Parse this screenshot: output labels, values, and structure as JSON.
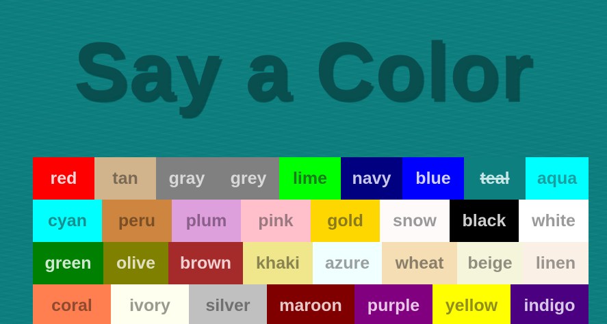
{
  "title": "Say a Color",
  "rows": [
    [
      {
        "label": "red",
        "bg": "#ff0000",
        "fg": "#f5d7d7",
        "w": 90
      },
      {
        "label": "tan",
        "bg": "#d2b48c",
        "fg": "#7a6a55",
        "w": 90
      },
      {
        "label": "gray",
        "bg": "#808080",
        "fg": "#d8d8d8",
        "w": 90
      },
      {
        "label": "grey",
        "bg": "#808080",
        "fg": "#d8d8d8",
        "w": 90
      },
      {
        "label": "lime",
        "bg": "#00ff00",
        "fg": "#1b7a1b",
        "w": 90
      },
      {
        "label": "navy",
        "bg": "#000080",
        "fg": "#c8c8e6",
        "w": 90
      },
      {
        "label": "blue",
        "bg": "#0000ff",
        "fg": "#d0d0f8",
        "w": 90
      },
      {
        "label": "teal",
        "bg": "#0d7f7f",
        "fg": "#c8e6e6",
        "w": 90,
        "crossed": true
      },
      {
        "label": "aqua",
        "bg": "#00ffff",
        "fg": "#1aa0a0",
        "w": 92
      }
    ],
    [
      {
        "label": "cyan",
        "bg": "#00ffff",
        "fg": "#1a8f8f",
        "w": 101
      },
      {
        "label": "peru",
        "bg": "#cd853f",
        "fg": "#7a4f25",
        "w": 102
      },
      {
        "label": "plum",
        "bg": "#dda0dd",
        "fg": "#8a5f8a",
        "w": 101
      },
      {
        "label": "pink",
        "bg": "#ffc0cb",
        "fg": "#9a7a80",
        "w": 102
      },
      {
        "label": "gold",
        "bg": "#ffd700",
        "fg": "#8a7a20",
        "w": 101
      },
      {
        "label": "snow",
        "bg": "#fffafa",
        "fg": "#9a9a9a",
        "w": 102
      },
      {
        "label": "black",
        "bg": "#000000",
        "fg": "#cfcfcf",
        "w": 101
      },
      {
        "label": "white",
        "bg": "#ffffff",
        "fg": "#9a9a9a",
        "w": 102
      }
    ],
    [
      {
        "label": "green",
        "bg": "#008000",
        "fg": "#cfe8cf",
        "w": 103
      },
      {
        "label": "olive",
        "bg": "#808000",
        "fg": "#e0e0c0",
        "w": 95
      },
      {
        "label": "brown",
        "bg": "#a52a2a",
        "fg": "#f0d0d0",
        "w": 109
      },
      {
        "label": "khaki",
        "bg": "#f0e68c",
        "fg": "#8a8450",
        "w": 102
      },
      {
        "label": "azure",
        "bg": "#f0ffff",
        "fg": "#9aa0a0",
        "w": 101
      },
      {
        "label": "wheat",
        "bg": "#f5deb3",
        "fg": "#8a7f6a",
        "w": 110
      },
      {
        "label": "beige",
        "bg": "#f5f5dc",
        "fg": "#8f8f80",
        "w": 96
      },
      {
        "label": "linen",
        "bg": "#faf0e6",
        "fg": "#9a948f",
        "w": 96
      }
    ],
    [
      {
        "label": "coral",
        "bg": "#ff7f50",
        "fg": "#8f4a30",
        "w": 114
      },
      {
        "label": "ivory",
        "bg": "#fffff0",
        "fg": "#9a9a90",
        "w": 114
      },
      {
        "label": "silver",
        "bg": "#c0c0c0",
        "fg": "#707070",
        "w": 114
      },
      {
        "label": "maroon",
        "bg": "#800000",
        "fg": "#e6c8c8",
        "w": 128
      },
      {
        "label": "purple",
        "bg": "#800080",
        "fg": "#e6c8e6",
        "w": 114
      },
      {
        "label": "yellow",
        "bg": "#ffff00",
        "fg": "#8f8f20",
        "w": 114
      },
      {
        "label": "indigo",
        "bg": "#4b0082",
        "fg": "#d8c8e6",
        "w": 114
      }
    ]
  ]
}
